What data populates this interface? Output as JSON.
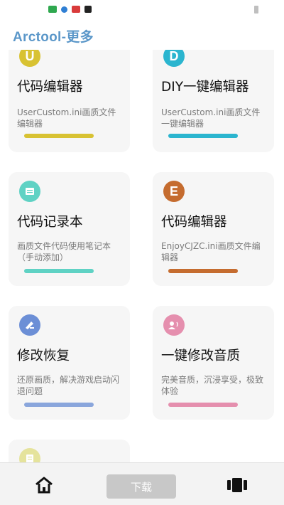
{
  "header": {
    "title": "Arctool-更多"
  },
  "cards": [
    {
      "icon_letter": "U",
      "icon_name": "letter-u-icon",
      "title": "代码编辑器",
      "desc": "UserCustom.ini画质文件编辑器",
      "icon_color": "#d8c232",
      "bar_color": "#d8c232"
    },
    {
      "icon_letter": "D",
      "icon_name": "letter-d-icon",
      "title": "DIY一键编辑器",
      "desc": "UserCustom.ini画质文件一键编辑器",
      "icon_color": "#2bb5cf",
      "bar_color": "#2bb5cf"
    },
    {
      "icon_letter": "",
      "icon_name": "notebook-icon",
      "title": "代码记录本",
      "desc": "画质文件代码使用笔记本（手动添加）",
      "icon_color": "#5fd2c4",
      "bar_color": "#5fd2c4"
    },
    {
      "icon_letter": "E",
      "icon_name": "letter-e-icon",
      "title": "代码编辑器",
      "desc": "EnjoyCJZC.ini画质文件编辑器",
      "icon_color": "#c56c2f",
      "bar_color": "#c56c2f"
    },
    {
      "icon_letter": "",
      "icon_name": "repair-icon",
      "title": "修改恢复",
      "desc": "还原画质，解决游戏启动闪退问题",
      "icon_color": "#6c8fd6",
      "bar_color": "#8aa6dc"
    },
    {
      "icon_letter": "",
      "icon_name": "audio-icon",
      "title": "一键修改音质",
      "desc": "完美音质，沉浸享受，极致体验",
      "icon_color": "#e58fae",
      "bar_color": "#e58fae"
    },
    {
      "icon_letter": "",
      "icon_name": "document-icon",
      "title": "",
      "desc": "",
      "icon_color": "#e5e39c",
      "bar_color": ""
    }
  ],
  "bottom_nav": {
    "home_icon": "home-icon",
    "download_label": "下载",
    "cards_icon": "card-carousel-icon"
  }
}
